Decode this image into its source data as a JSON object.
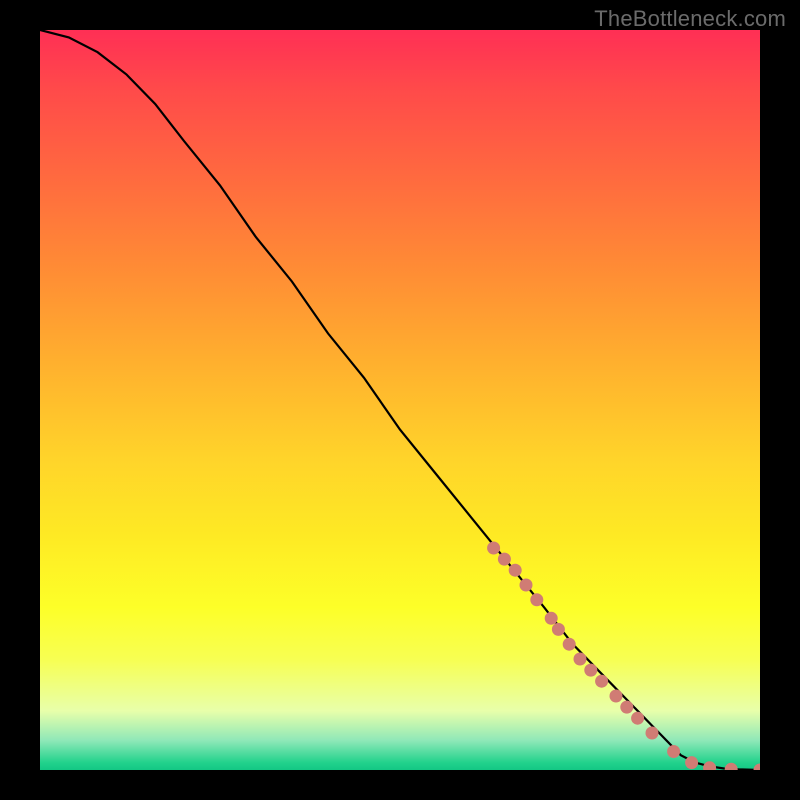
{
  "attribution": "TheBottleneck.com",
  "chart_data": {
    "type": "line",
    "title": "",
    "xlabel": "",
    "ylabel": "",
    "xlim": [
      0,
      100
    ],
    "ylim": [
      0,
      100
    ],
    "series": [
      {
        "name": "curve",
        "style": "line",
        "color": "#000000",
        "x": [
          0,
          4,
          8,
          12,
          16,
          20,
          25,
          30,
          35,
          40,
          45,
          50,
          55,
          60,
          65,
          70,
          74,
          78,
          82,
          86,
          89,
          91,
          93,
          95,
          97,
          100
        ],
        "y": [
          100,
          99,
          97,
          94,
          90,
          85,
          79,
          72,
          66,
          59,
          53,
          46,
          40,
          34,
          28,
          22,
          17,
          13,
          9,
          5,
          2,
          1,
          0.5,
          0.2,
          0.1,
          0
        ]
      },
      {
        "name": "highlighted-segment",
        "style": "dots",
        "color": "#d07c74",
        "x": [
          63,
          64.5,
          66,
          67.5,
          69,
          71,
          72,
          73.5,
          75,
          76.5,
          78,
          80,
          81.5,
          83,
          85,
          88,
          90.5,
          93,
          96,
          100
        ],
        "y": [
          30,
          28.5,
          27,
          25,
          23,
          20.5,
          19,
          17,
          15,
          13.5,
          12,
          10,
          8.5,
          7,
          5,
          2.5,
          1,
          0.3,
          0.1,
          0
        ]
      }
    ]
  }
}
